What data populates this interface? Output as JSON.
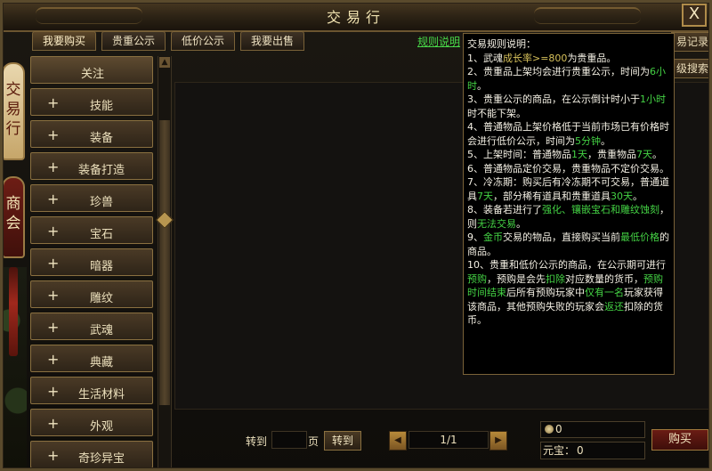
{
  "window": {
    "title": "交易行",
    "close_label": "X"
  },
  "side_tabs": [
    {
      "label": "交易行",
      "active": true
    },
    {
      "label": "商会",
      "active": false
    }
  ],
  "top_tabs": [
    {
      "label": "我要购买",
      "active": true
    },
    {
      "label": "贵重公示",
      "active": false
    },
    {
      "label": "低价公示",
      "active": false
    },
    {
      "label": "我要出售",
      "active": false
    }
  ],
  "rules_link": "规则说明",
  "record_button": "易记录",
  "search_button": "级搜索",
  "categories": [
    {
      "label": "关注",
      "plus": false,
      "selected": true
    },
    {
      "label": "技能",
      "plus": true
    },
    {
      "label": "装备",
      "plus": true
    },
    {
      "label": "装备打造",
      "plus": true
    },
    {
      "label": "珍兽",
      "plus": true
    },
    {
      "label": "宝石",
      "plus": true
    },
    {
      "label": "暗器",
      "plus": true
    },
    {
      "label": "雕纹",
      "plus": true
    },
    {
      "label": "武魂",
      "plus": true
    },
    {
      "label": "典藏",
      "plus": true
    },
    {
      "label": "生活材料",
      "plus": true
    },
    {
      "label": "外观",
      "plus": true
    },
    {
      "label": "奇珍异宝",
      "plus": true
    }
  ],
  "rules": {
    "heading": "交易规则说明：",
    "items": [
      [
        {
          "t": "1、武魂"
        },
        {
          "t": "成长率>=800",
          "c": "y"
        },
        {
          "t": "为贵重品。"
        }
      ],
      [
        {
          "t": "2、贵重品上架均会进行贵重公示，时间为"
        },
        {
          "t": "6小时",
          "c": "g"
        },
        {
          "t": "。"
        }
      ],
      [
        {
          "t": "3、贵重公示的商品，在公示倒计时小于"
        },
        {
          "t": "1小时",
          "c": "g"
        },
        {
          "t": "时不能下架。"
        }
      ],
      [
        {
          "t": "4、普通物品上架价格低于当前市场已有价格时会进行低价公示，时间为"
        },
        {
          "t": "5分钟",
          "c": "g"
        },
        {
          "t": "。"
        }
      ],
      [
        {
          "t": "5、上架时间：普通物品"
        },
        {
          "t": "1天",
          "c": "g"
        },
        {
          "t": "，贵重物品"
        },
        {
          "t": "7天",
          "c": "g"
        },
        {
          "t": "。"
        }
      ],
      [
        {
          "t": "6、普通物品定价交易，贵重物品不定价交易。"
        }
      ],
      [
        {
          "t": "7、冷冻期：购买后有冷冻期不可交易，普通道具"
        },
        {
          "t": "7天",
          "c": "g"
        },
        {
          "t": "，部分稀有道具和贵重道具"
        },
        {
          "t": "30天",
          "c": "g"
        },
        {
          "t": "。"
        }
      ],
      [
        {
          "t": "8、装备若进行了"
        },
        {
          "t": "强化、镶嵌宝石和雕纹蚀刻",
          "c": "g"
        },
        {
          "t": "，则"
        },
        {
          "t": "无法交易",
          "c": "g"
        },
        {
          "t": "。"
        }
      ],
      [
        {
          "t": "9、"
        },
        {
          "t": "金币",
          "c": "g"
        },
        {
          "t": "交易的物品，直接购买当前"
        },
        {
          "t": "最低价格",
          "c": "g"
        },
        {
          "t": "的商品。"
        }
      ],
      [
        {
          "t": "10、贵重和低价公示的商品，在公示期可进行"
        },
        {
          "t": "预购",
          "c": "g"
        },
        {
          "t": "，预购是会先"
        },
        {
          "t": "扣除",
          "c": "g"
        },
        {
          "t": "对应数量的货币，"
        },
        {
          "t": "预购时间结束",
          "c": "g"
        },
        {
          "t": "后所有预购玩家中"
        },
        {
          "t": "仅有一名",
          "c": "g"
        },
        {
          "t": "玩家获得该商品，其他预购失败的玩家会"
        },
        {
          "t": "返还",
          "c": "g"
        },
        {
          "t": "扣除的货币。"
        }
      ]
    ]
  },
  "pager": {
    "goto_label": "转到",
    "page_unit": "页",
    "goto_button": "转到",
    "page_display": "1/1",
    "goto_value": ""
  },
  "currency": {
    "coin_value": "0",
    "yuanbao_label": "元宝：",
    "yuanbao_value": "0"
  },
  "buy_button": "购买",
  "icons": {
    "close": "close-icon",
    "plus": "plus-icon",
    "coin": "coin-icon",
    "prev": "left-arrow-icon",
    "next": "right-arrow-icon"
  }
}
